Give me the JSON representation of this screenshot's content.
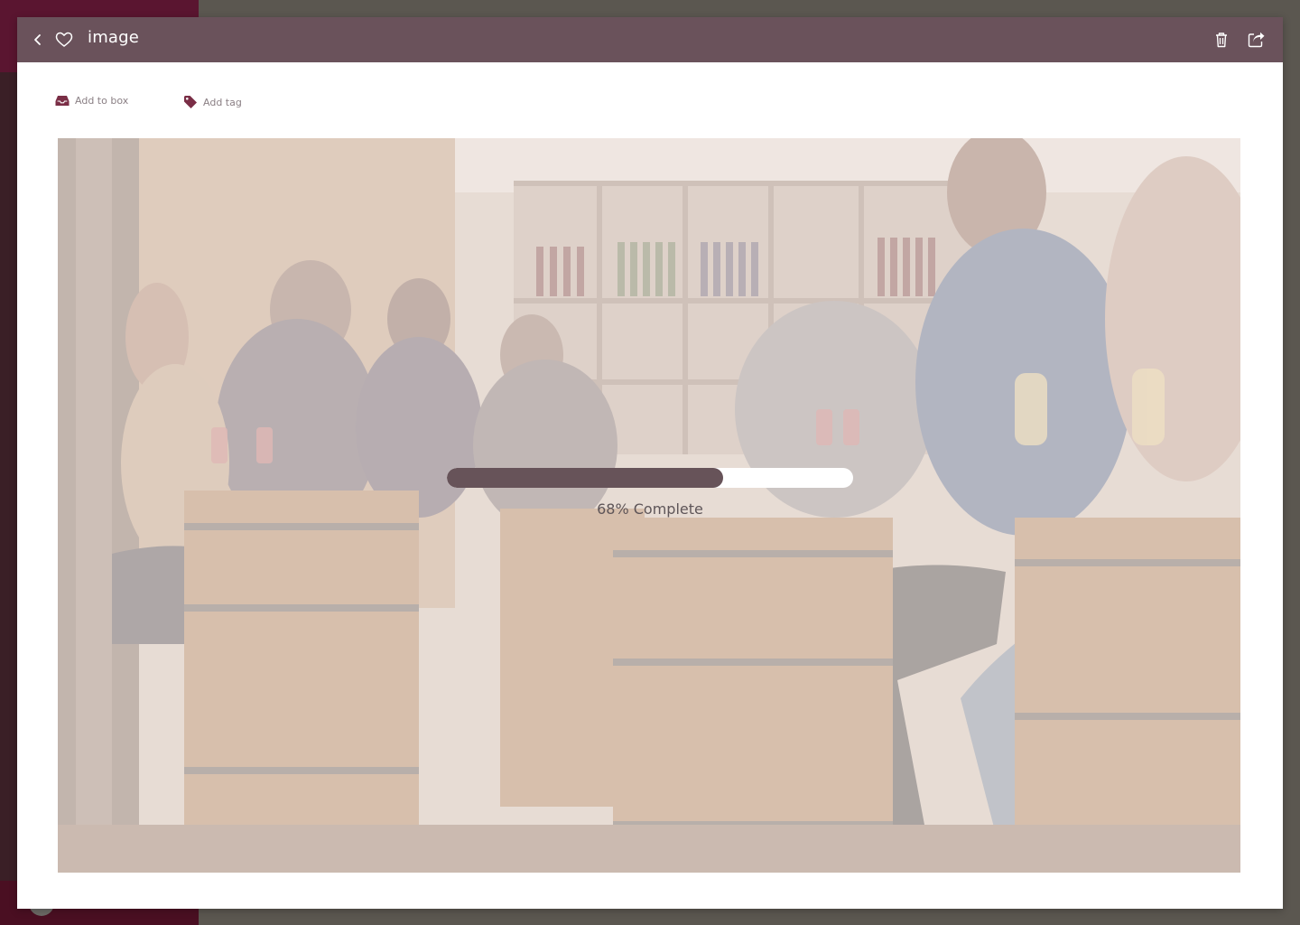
{
  "viewer": {
    "title": "image",
    "actions": {
      "add_to_box": "Add to box",
      "add_tag": "Add tag"
    },
    "progress": {
      "percent": 68,
      "label": "68% Complete"
    }
  },
  "icons": {
    "back": "chevron-left-icon",
    "favorite": "heart-icon",
    "delete": "trash-icon",
    "share": "share-icon",
    "box": "inbox-icon",
    "tag": "tag-icon"
  },
  "colors": {
    "header": "#6a525b",
    "accent": "#7a2e46",
    "progress_fill": "#675359",
    "progress_track": "#ffffff"
  }
}
